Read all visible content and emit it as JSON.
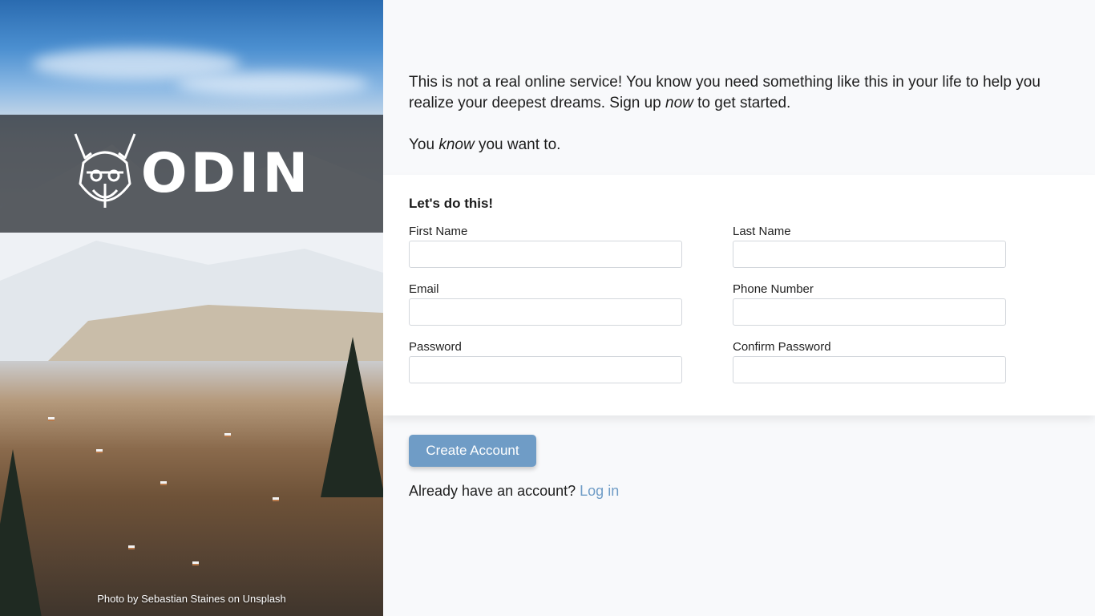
{
  "sidebar": {
    "logo_text": "ODIN",
    "photo_credit": "Photo by Sebastian Staines on Unsplash"
  },
  "intro": {
    "line1_a": "This is not a real online service! You know you need something like this in your life to help you realize your deepest dreams. Sign up ",
    "line1_em": "now",
    "line1_b": " to get started.",
    "line2_a": "You ",
    "line2_em": "know",
    "line2_b": " you want to."
  },
  "form": {
    "title": "Let's do this!",
    "fields": {
      "first_name": {
        "label": "First Name",
        "value": ""
      },
      "last_name": {
        "label": "Last Name",
        "value": ""
      },
      "email": {
        "label": "Email",
        "value": ""
      },
      "phone": {
        "label": "Phone Number",
        "value": ""
      },
      "password": {
        "label": "Password",
        "value": ""
      },
      "confirm_password": {
        "label": "Confirm Password",
        "value": ""
      }
    }
  },
  "actions": {
    "create_label": "Create Account",
    "login_prompt": "Already have an account? ",
    "login_link": "Log in"
  },
  "colors": {
    "accent": "#6f9cc6",
    "background": "#f8f9fb",
    "card": "#ffffff"
  }
}
